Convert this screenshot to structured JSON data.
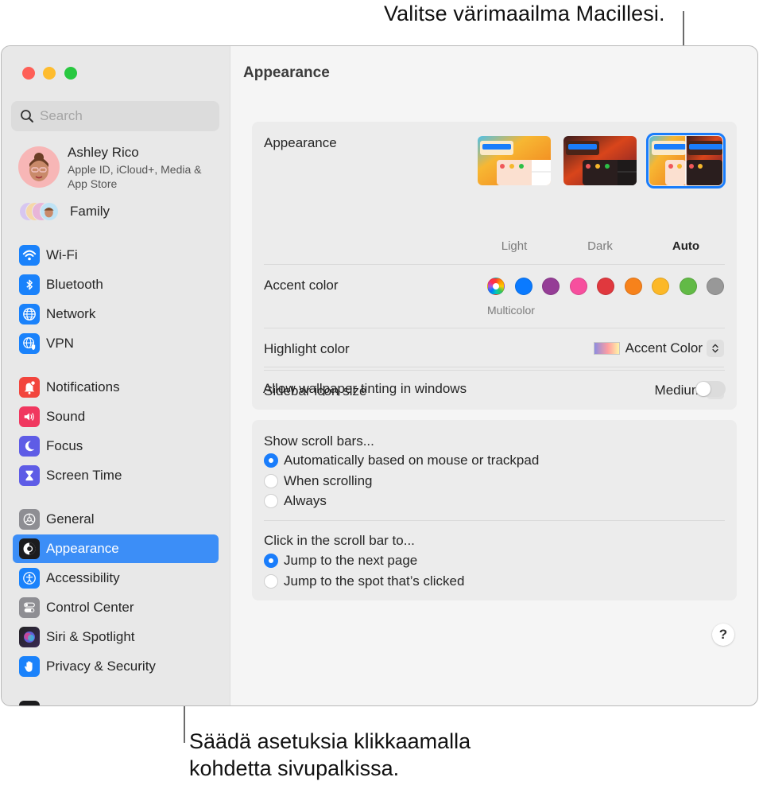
{
  "callouts": {
    "top": "Valitse värimaailma Macillesi.",
    "bottom_line1": "Säädä asetuksia klikkaamalla",
    "bottom_line2": "kohdetta sivupalkissa."
  },
  "window": {
    "traffic_lights": [
      {
        "name": "close",
        "color": "#fe5f57"
      },
      {
        "name": "minimize",
        "color": "#febc2e"
      },
      {
        "name": "zoom",
        "color": "#28c840"
      }
    ]
  },
  "sidebar": {
    "search_placeholder": "Search",
    "profile": {
      "name": "Ashley Rico",
      "subtitle": "Apple ID, iCloud+, Media & App Store"
    },
    "family_label": "Family",
    "items": [
      {
        "label": "Wi-Fi",
        "icon": "wifi-icon",
        "color": "#1a82fb"
      },
      {
        "label": "Bluetooth",
        "icon": "bluetooth-icon",
        "color": "#1a82fb"
      },
      {
        "label": "Network",
        "icon": "globe-icon",
        "color": "#1a82fb"
      },
      {
        "label": "VPN",
        "icon": "vpn-globe-shield-icon",
        "color": "#1a82fb"
      },
      {
        "label": "Notifications",
        "icon": "bell-badge-icon",
        "color": "#f2453d"
      },
      {
        "label": "Sound",
        "icon": "speaker-icon",
        "color": "#f0375f"
      },
      {
        "label": "Focus",
        "icon": "moon-icon",
        "color": "#5e5ce6"
      },
      {
        "label": "Screen Time",
        "icon": "hourglass-icon",
        "color": "#5e5ce6"
      },
      {
        "label": "General",
        "icon": "gear-icon",
        "color": "#8e8e93"
      },
      {
        "label": "Appearance",
        "icon": "appearance-icon",
        "color": "#1c1c1e",
        "active": true
      },
      {
        "label": "Accessibility",
        "icon": "accessibility-icon",
        "color": "#1a82fb"
      },
      {
        "label": "Control Center",
        "icon": "toggles-icon",
        "color": "#8e8e93"
      },
      {
        "label": "Siri & Spotlight",
        "icon": "siri-icon",
        "color": "#6b3fa0"
      },
      {
        "label": "Privacy & Security",
        "icon": "hand-icon",
        "color": "#1a82fb"
      }
    ]
  },
  "main": {
    "title": "Appearance",
    "appearance": {
      "label": "Appearance",
      "options": [
        {
          "label": "Light",
          "selected": false
        },
        {
          "label": "Dark",
          "selected": false
        },
        {
          "label": "Auto",
          "selected": true
        }
      ]
    },
    "accent": {
      "label": "Accent color",
      "selected_label": "Multicolor",
      "colors": [
        "multicolor",
        "#0a7aff",
        "#953d96",
        "#f74f9e",
        "#e0383e",
        "#f7821b",
        "#fcb827",
        "#62ba46",
        "#989898"
      ]
    },
    "highlight": {
      "label": "Highlight color",
      "value": "Accent Color"
    },
    "sidebar_icon_size": {
      "label": "Sidebar icon size",
      "value": "Medium"
    },
    "wallpaper_tinting": {
      "label": "Allow wallpaper tinting in windows",
      "enabled": false
    },
    "show_scroll_bars": {
      "heading": "Show scroll bars...",
      "options": [
        {
          "label": "Automatically based on mouse or trackpad",
          "checked": true
        },
        {
          "label": "When scrolling",
          "checked": false
        },
        {
          "label": "Always",
          "checked": false
        }
      ]
    },
    "click_scroll_bar": {
      "heading": "Click in the scroll bar to...",
      "options": [
        {
          "label": "Jump to the next page",
          "checked": true
        },
        {
          "label": "Jump to the spot that’s clicked",
          "checked": false
        }
      ]
    },
    "help_label": "?"
  },
  "colors": {
    "accent": "#1a7dfb",
    "sidebar_selection": "#3c8ef7"
  }
}
